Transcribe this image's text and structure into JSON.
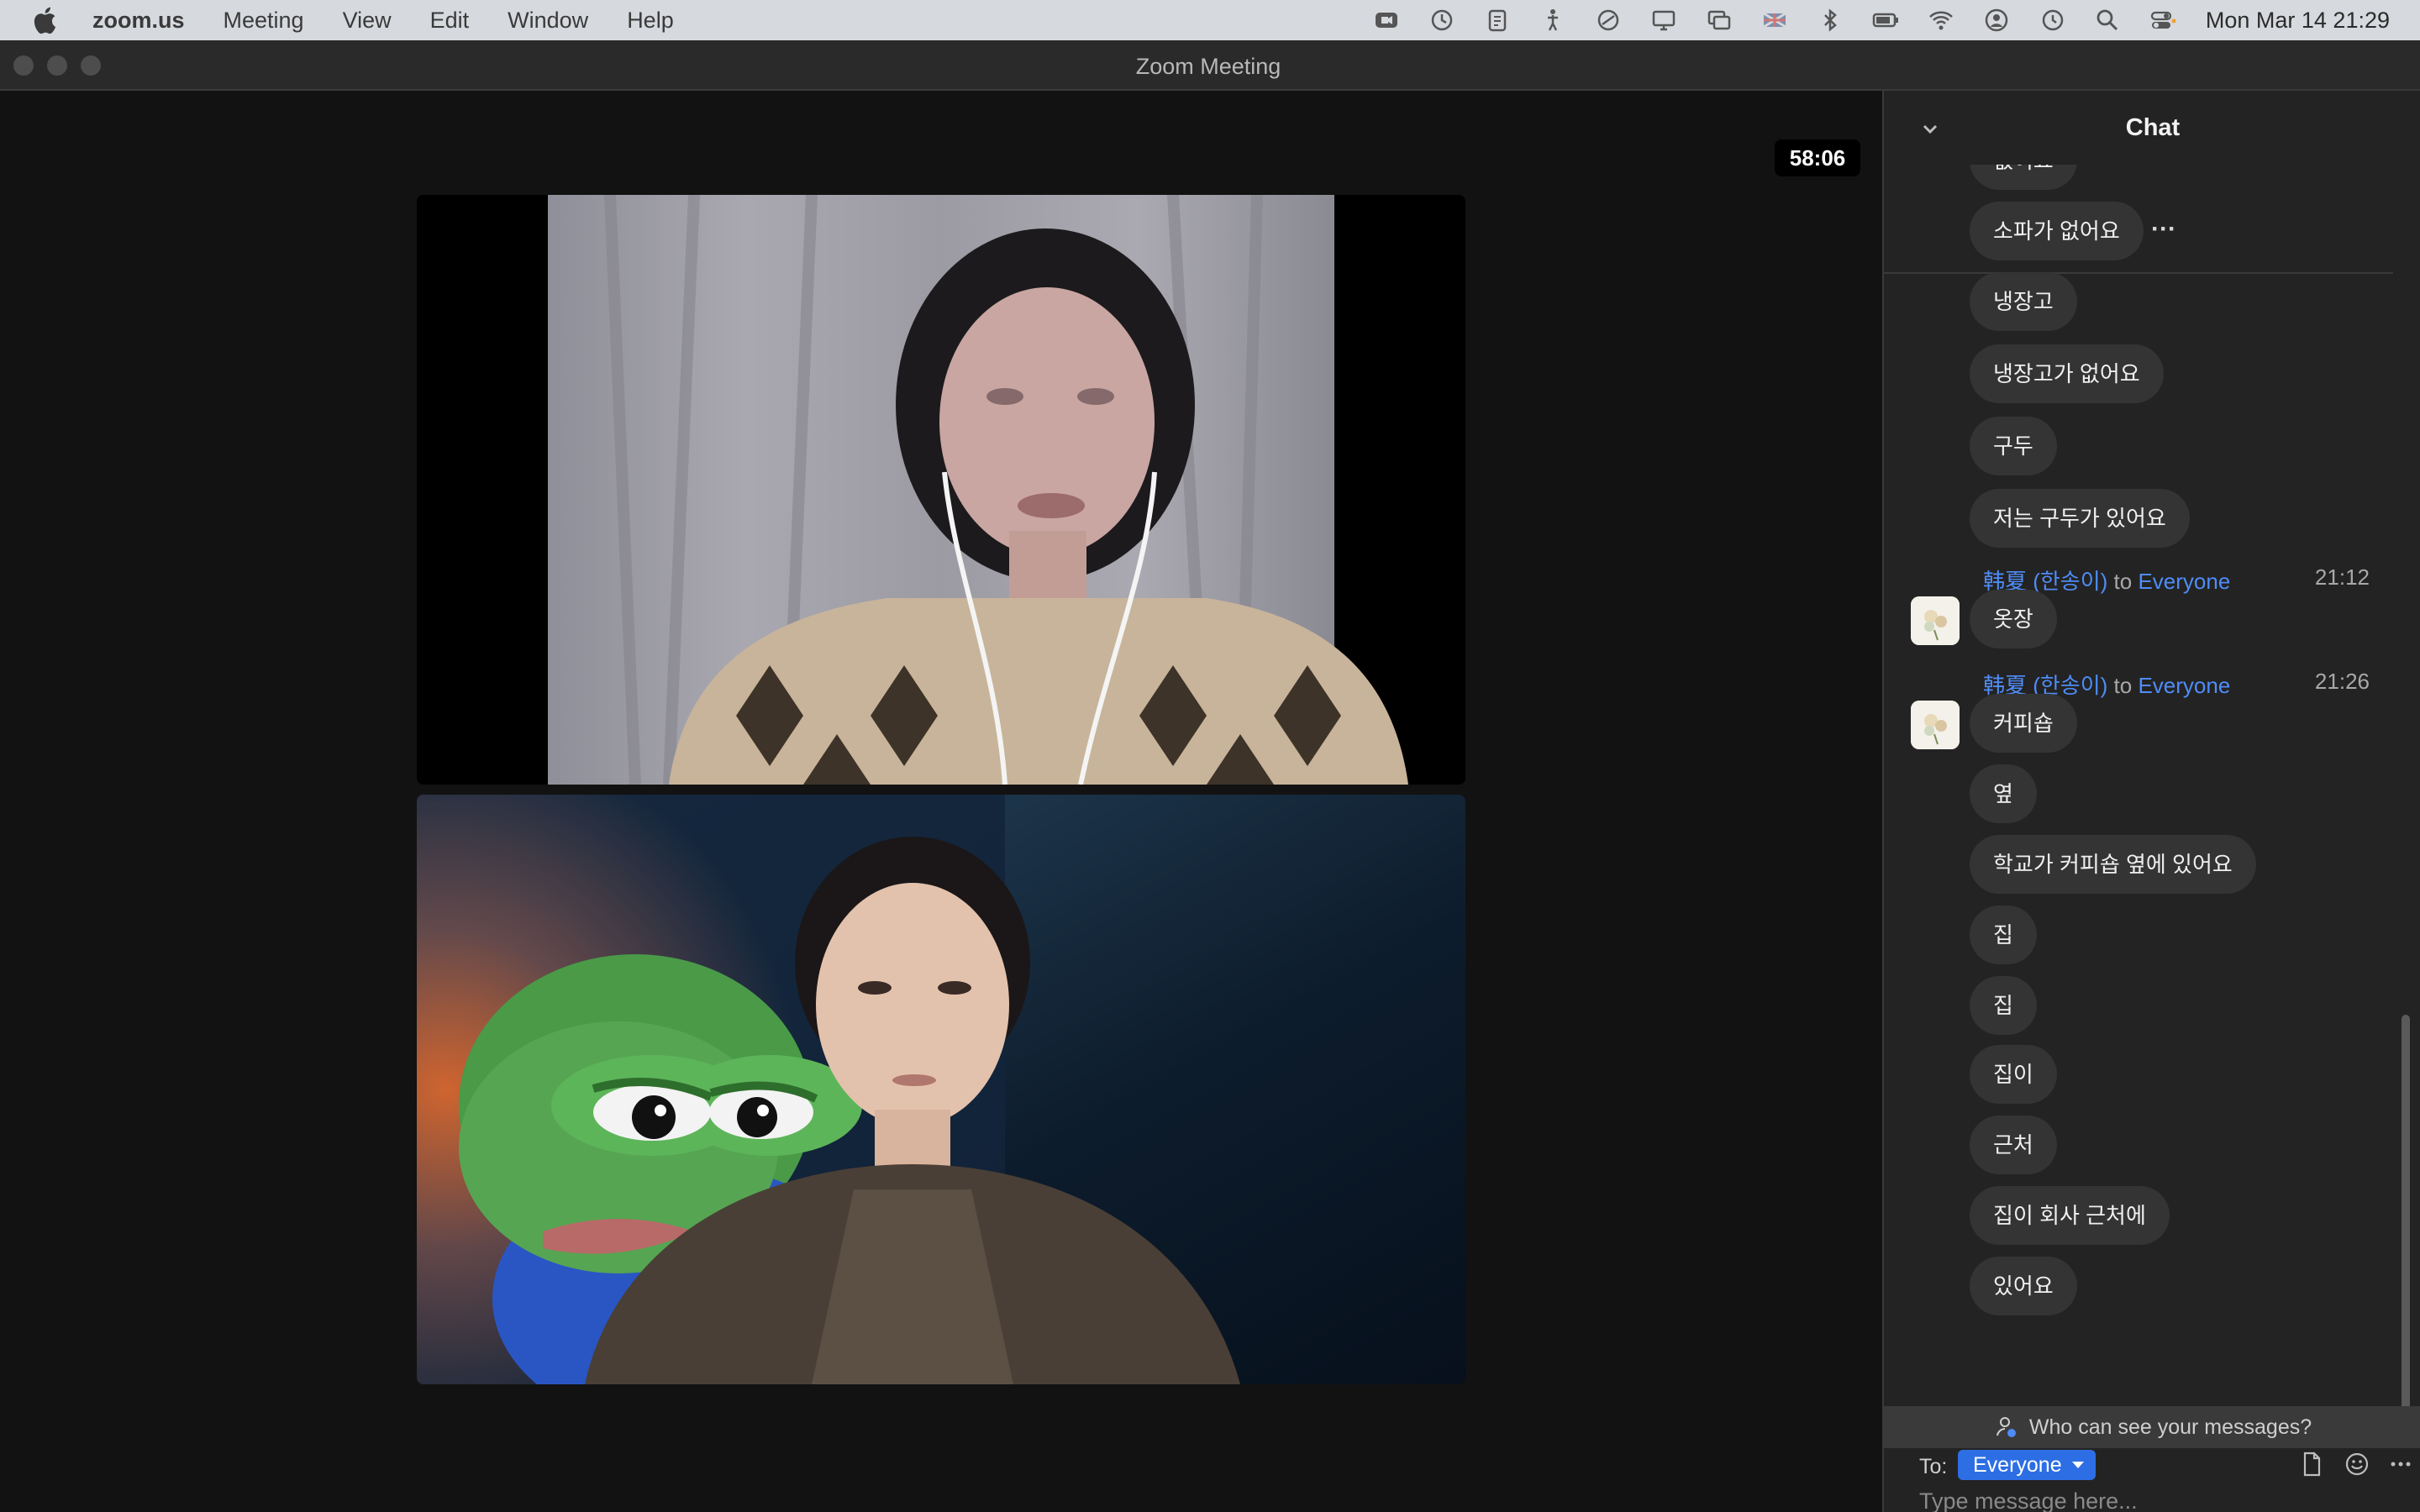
{
  "menubar": {
    "app": "zoom.us",
    "menus": [
      "Meeting",
      "View",
      "Edit",
      "Window",
      "Help"
    ],
    "clock": "Mon Mar 14  21:29"
  },
  "window": {
    "title": "Zoom Meeting"
  },
  "meeting": {
    "timer": "58:06"
  },
  "chat": {
    "title": "Chat",
    "messages_top": [
      "없어요",
      "소파가 없어요"
    ],
    "messages_mid": [
      "냉장고",
      "냉장고가 없어요",
      "구두",
      "저는 구두가 있어요"
    ],
    "group1": {
      "sender": "韩夏 (한송이)",
      "to_word": "to",
      "recipient": "Everyone",
      "time": "21:12",
      "messages": [
        "옷장"
      ]
    },
    "group2": {
      "sender": "韩夏 (한송이)",
      "to_word": "to",
      "recipient": "Everyone",
      "time": "21:26",
      "messages": [
        "커피숍",
        "옆",
        "학교가 커피숍 옆에 있어요",
        "집",
        "집",
        "집이",
        "근처",
        "집이 회사 근처에",
        "있어요"
      ]
    },
    "more_label": "···",
    "who_can_see": "Who can see your messages?",
    "to_label": "To:",
    "to_value": "Everyone",
    "input_placeholder": "Type message here..."
  },
  "colors": {
    "accent": "#2d6ee4",
    "sender_link": "#4f8cf7",
    "panel_bg": "#232323",
    "bubble_bg": "#343434"
  }
}
